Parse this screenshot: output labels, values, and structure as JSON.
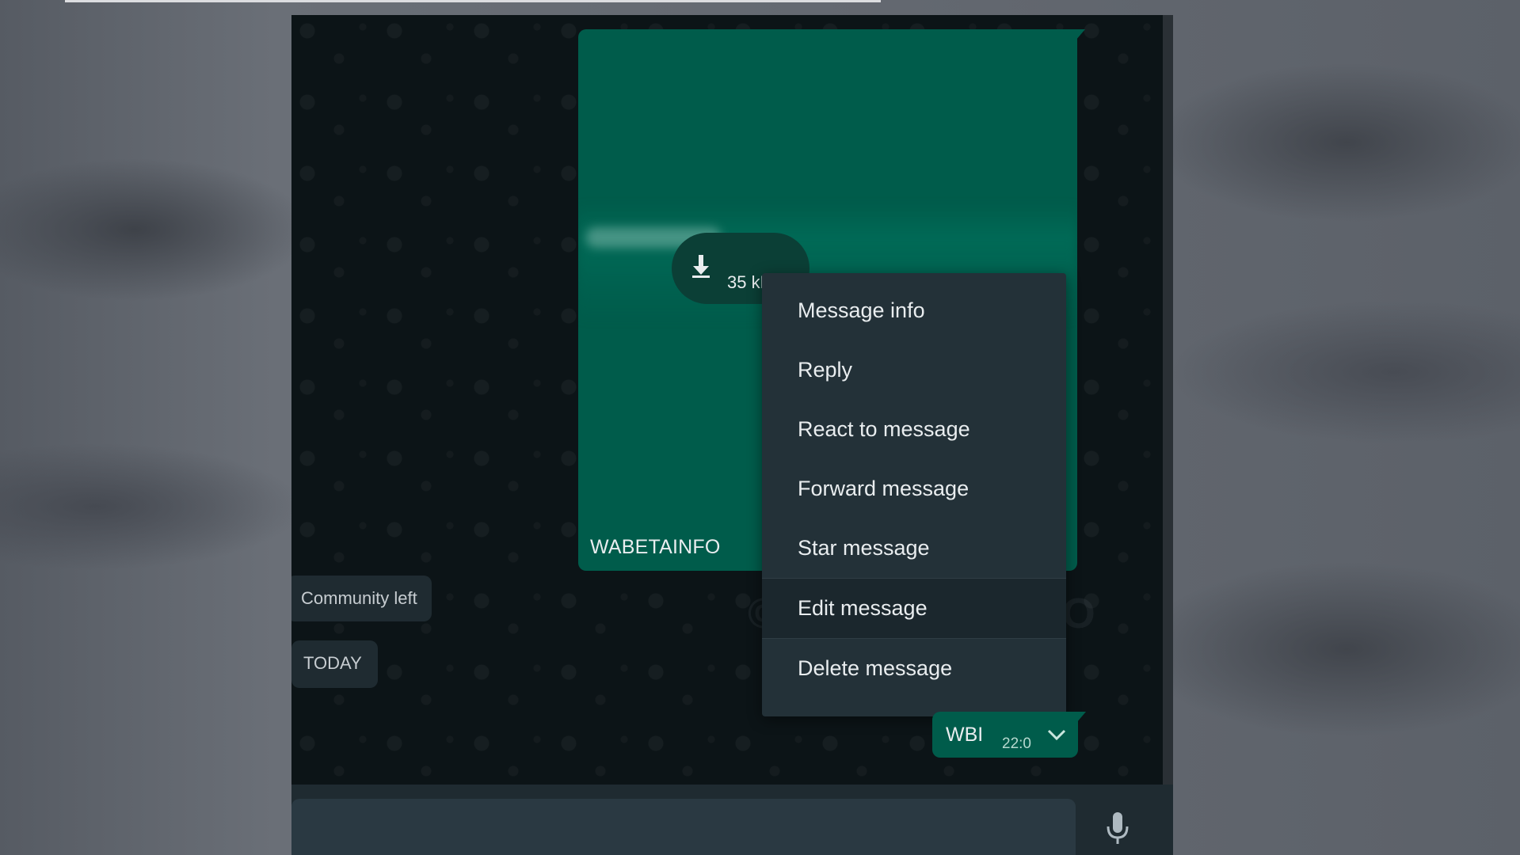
{
  "message": {
    "caption": "WABETAINFO",
    "download_size": "35 kB"
  },
  "chat": {
    "system_notice": "Community left",
    "date_separator": "TODAY"
  },
  "sent_message": {
    "text": "WBI",
    "time": "22:0"
  },
  "context_menu": {
    "items": [
      {
        "label": "Message info"
      },
      {
        "label": "Reply"
      },
      {
        "label": "React to message"
      },
      {
        "label": "Forward message"
      },
      {
        "label": "Star message"
      },
      {
        "label": "Edit message"
      },
      {
        "label": "Delete message"
      }
    ]
  },
  "watermark": "©WABETAINFO",
  "colors": {
    "bubble_outgoing": "#005c4b",
    "menu_background": "#233138",
    "chat_background": "#0c1417"
  }
}
